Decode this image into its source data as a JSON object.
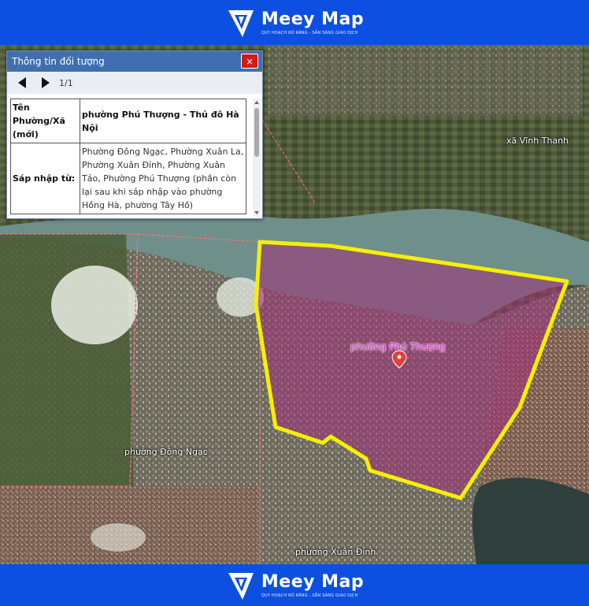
{
  "brand": {
    "name": "Meey Map",
    "slogan": "QUY HOẠCH RÕ RÀNG - SẴN SÀNG GIAO DỊCH",
    "color": "#0d4fe0"
  },
  "panel": {
    "title": "Thông tin đối tượng",
    "close_icon": "×",
    "pager": "1/1",
    "rows": [
      {
        "key": "Tên Phường/Xã (mới)",
        "value": "phường Phú Thượng - Thủ đô Hà Nội"
      },
      {
        "key": "Sáp nhập từ:",
        "value": "Phường Đông Ngạc, Phường Xuân La, Phường Xuân Đỉnh, Phường Xuân Tảo, Phường Phú Thượng (phần còn lại sau khi sáp nhập vào phường Hồng Hà, phường Tây Hồ)"
      }
    ]
  },
  "map": {
    "labels": {
      "selected": "phường Phú Thượng",
      "vinh_thanh": "xã Vĩnh Thanh",
      "dong_ngac": "phường Đông Ngạc",
      "xuan_dinh": "phường Xuân Đỉnh"
    },
    "highlight_color": "#f5f000",
    "fill_color": "#a0307a",
    "marker_color": "#e0403a"
  }
}
